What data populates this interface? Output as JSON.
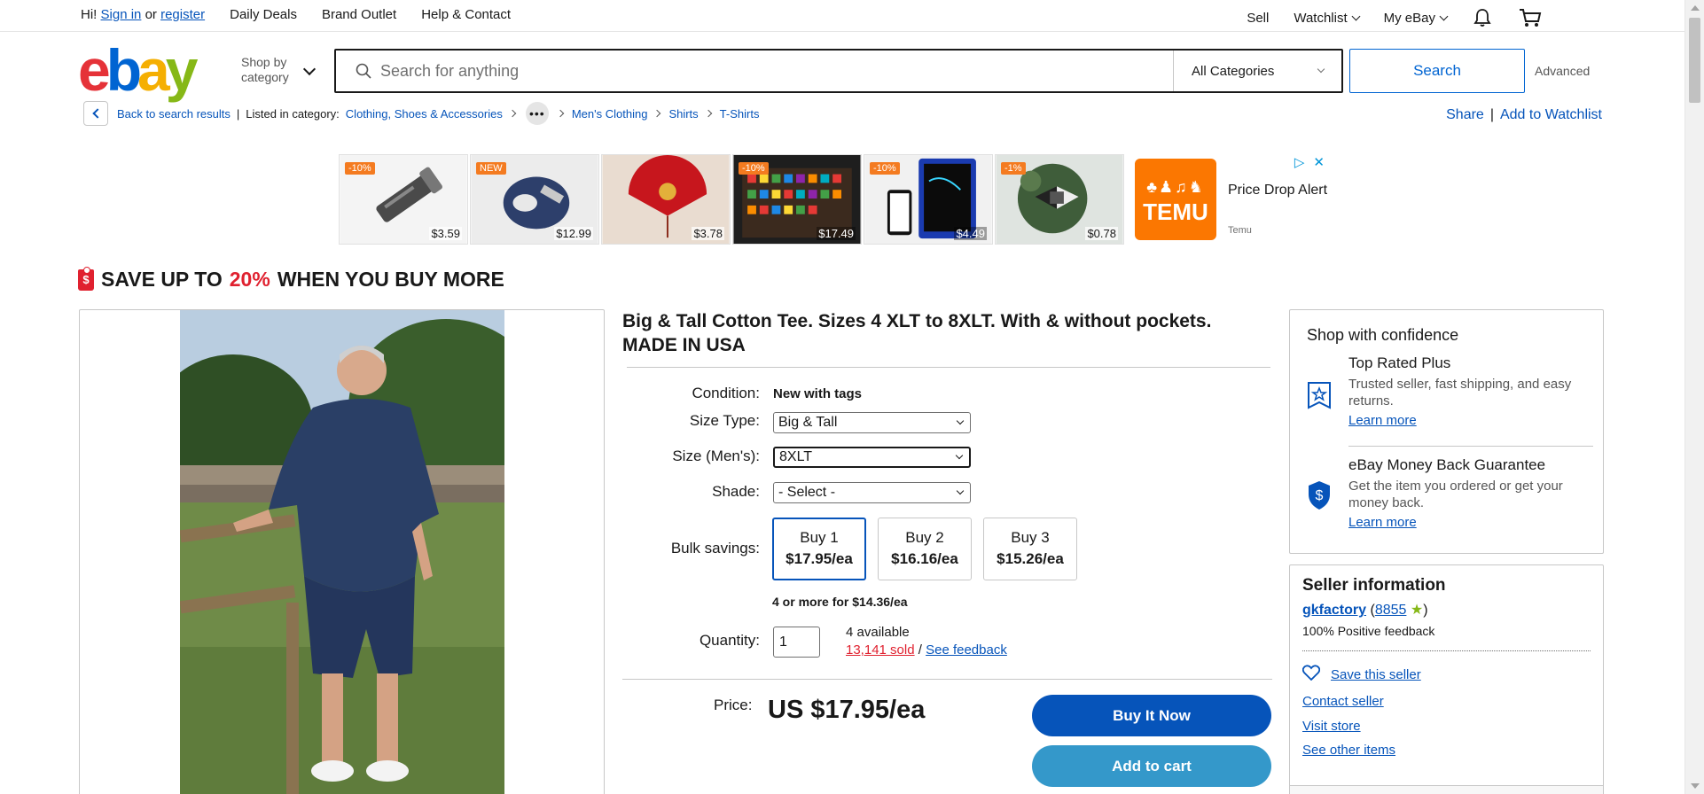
{
  "topbar": {
    "greeting": "Hi!",
    "sign_in": "Sign in",
    "or": "or",
    "register": "register",
    "daily_deals": "Daily Deals",
    "brand_outlet": "Brand Outlet",
    "help_contact": "Help & Contact",
    "sell": "Sell",
    "watchlist": "Watchlist",
    "my_ebay": "My eBay"
  },
  "header": {
    "logo_letters": [
      "e",
      "b",
      "a",
      "y"
    ],
    "shop_by_category": "Shop by category",
    "search_placeholder": "Search for anything",
    "category_select": "All Categories",
    "search_button": "Search",
    "advanced": "Advanced"
  },
  "breadcrumb": {
    "back": "Back to search results",
    "listed_in": "Listed in category:",
    "items": [
      "Clothing, Shoes & Accessories",
      "Men's Clothing",
      "Shirts",
      "T-Shirts"
    ],
    "share": "Share",
    "add_watchlist": "Add to Watchlist"
  },
  "ads": {
    "items": [
      {
        "tag": "-10%",
        "price": "$3.59"
      },
      {
        "tag": "NEW",
        "price": "$12.99"
      },
      {
        "tag": "",
        "price": "$3.78"
      },
      {
        "tag": "-10%",
        "price": "$17.49"
      },
      {
        "tag": "-10%",
        "price": "$4.49"
      },
      {
        "tag": "-1%",
        "price": "$0.78"
      }
    ],
    "temu_logo": "TEMU",
    "temu_headline": "Price Drop Alert",
    "temu_source": "Temu"
  },
  "promo": {
    "prefix": "SAVE UP TO",
    "percent": "20%",
    "suffix": "WHEN YOU BUY MORE",
    "icon_glyph": "$"
  },
  "listing": {
    "title": "Big & Tall Cotton Tee. Sizes 4 XLT to 8XLT. With & without pockets. MADE IN USA",
    "condition_label": "Condition:",
    "condition_value": "New with tags",
    "size_type_label": "Size Type:",
    "size_type_value": "Big & Tall",
    "size_label": "Size (Men's):",
    "size_value": "8XLT",
    "shade_label": "Shade:",
    "shade_value": "- Select -",
    "bulk_label": "Bulk savings:",
    "bulk_options": [
      {
        "qty": "Buy 1",
        "price": "$17.95/ea"
      },
      {
        "qty": "Buy 2",
        "price": "$16.16/ea"
      },
      {
        "qty": "Buy 3",
        "price": "$15.26/ea"
      }
    ],
    "four_or_more": "4 or more for $14.36/ea",
    "quantity_label": "Quantity:",
    "quantity_value": "1",
    "available": "4 available",
    "sold": "13,141 sold",
    "slash": "/",
    "see_feedback": "See feedback",
    "price_label": "Price:",
    "price_value": "US $17.95/ea",
    "buy_now": "Buy It Now",
    "add_to_cart": "Add to cart"
  },
  "confidence": {
    "title": "Shop with confidence",
    "items": [
      {
        "title": "Top Rated Plus",
        "desc": "Trusted seller, fast shipping, and easy returns.",
        "link": "Learn more"
      },
      {
        "title": "eBay Money Back Guarantee",
        "desc": "Get the item you ordered or get your money back.",
        "link": "Learn more"
      }
    ]
  },
  "seller": {
    "title": "Seller information",
    "name": "gkfactory",
    "score": "8855",
    "feedback": "100% Positive feedback",
    "save": "Save this seller",
    "contact": "Contact seller",
    "visit": "Visit store",
    "other": "See other items"
  },
  "colors": {
    "ebay_red": "#e53238",
    "ebay_blue": "#0064d2",
    "ebay_yellow": "#f5af02",
    "ebay_green": "#86b817",
    "link_blue": "#0654ba",
    "buy_now_blue": "#0654ba",
    "cart_blue": "#3498ca",
    "sale_red": "#e0212f",
    "temu_orange": "#fb7701"
  }
}
